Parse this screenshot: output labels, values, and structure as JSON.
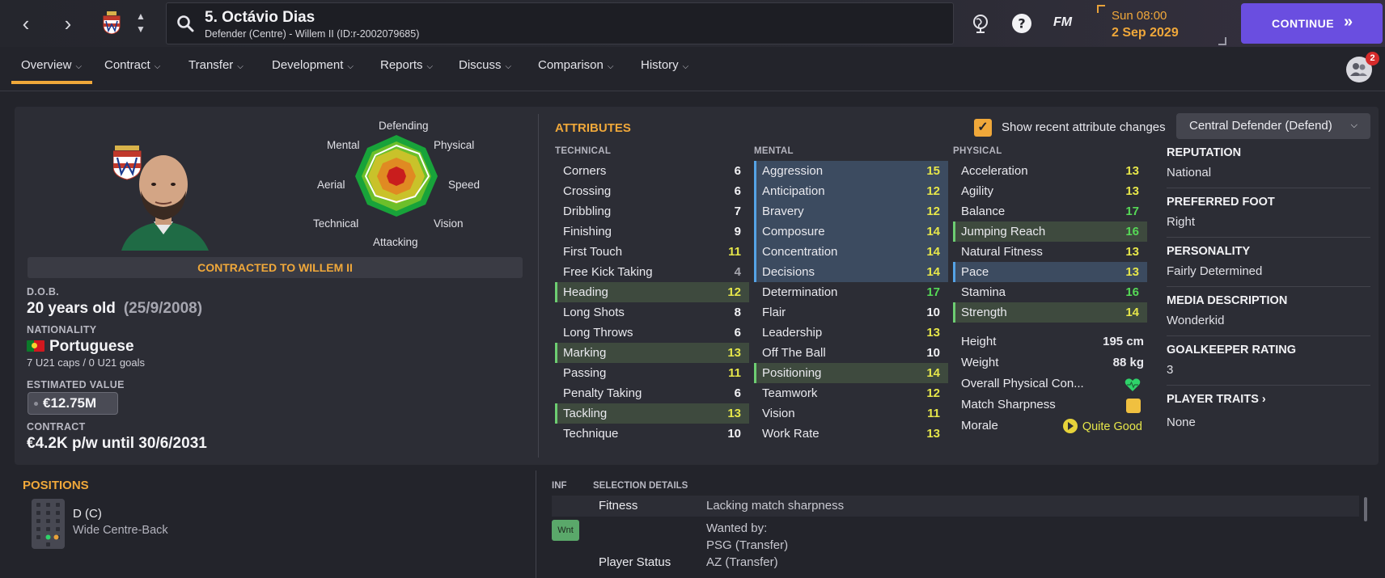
{
  "header": {
    "player_title": "5. Octávio Dias",
    "player_subtitle": "Defender (Centre) - Willem II (ID:r-2002079685)",
    "fm_logo": "FM",
    "date_time": "Sun 08:00",
    "date_day": "2 Sep 2029",
    "continue_label": "CONTINUE",
    "social_badge_count": "2"
  },
  "tabs": [
    {
      "label": "Overview"
    },
    {
      "label": "Contract"
    },
    {
      "label": "Transfer"
    },
    {
      "label": "Development"
    },
    {
      "label": "Reports"
    },
    {
      "label": "Discuss"
    },
    {
      "label": "Comparison"
    },
    {
      "label": "History"
    }
  ],
  "profile": {
    "contract_status": "CONTRACTED TO WILLEM II",
    "dob_label": "D.O.B.",
    "age": "20 years old",
    "dob": "(25/9/2008)",
    "nationality_label": "NATIONALITY",
    "nationality": "Portuguese",
    "caps": "7 U21 caps / 0 U21 goals",
    "value_label": "ESTIMATED VALUE",
    "value": "€12.75M",
    "contract_label": "CONTRACT",
    "contract": "€4.2K p/w until 30/6/2031"
  },
  "radar": {
    "labels": {
      "defending": "Defending",
      "physical": "Physical",
      "speed": "Speed",
      "vision": "Vision",
      "attacking": "Attacking",
      "technical": "Technical",
      "aerial": "Aerial",
      "mental": "Mental"
    }
  },
  "attributes": {
    "header": "ATTRIBUTES",
    "recent_changes_label": "Show recent attribute changes",
    "role": "Central Defender (Defend)",
    "technical_header": "TECHNICAL",
    "mental_header": "MENTAL",
    "physical_header": "PHYSICAL",
    "technical": [
      {
        "name": "Corners",
        "value": "6",
        "hl": ""
      },
      {
        "name": "Crossing",
        "value": "6",
        "hl": ""
      },
      {
        "name": "Dribbling",
        "value": "7",
        "hl": ""
      },
      {
        "name": "Finishing",
        "value": "9",
        "hl": ""
      },
      {
        "name": "First Touch",
        "value": "11",
        "hl": ""
      },
      {
        "name": "Free Kick Taking",
        "value": "4",
        "hl": ""
      },
      {
        "name": "Heading",
        "value": "12",
        "hl": "green"
      },
      {
        "name": "Long Shots",
        "value": "8",
        "hl": ""
      },
      {
        "name": "Long Throws",
        "value": "6",
        "hl": ""
      },
      {
        "name": "Marking",
        "value": "13",
        "hl": "green"
      },
      {
        "name": "Passing",
        "value": "11",
        "hl": ""
      },
      {
        "name": "Penalty Taking",
        "value": "6",
        "hl": ""
      },
      {
        "name": "Tackling",
        "value": "13",
        "hl": "green"
      },
      {
        "name": "Technique",
        "value": "10",
        "hl": ""
      }
    ],
    "mental": [
      {
        "name": "Aggression",
        "value": "15",
        "hl": "blue"
      },
      {
        "name": "Anticipation",
        "value": "12",
        "hl": "blue"
      },
      {
        "name": "Bravery",
        "value": "12",
        "hl": "blue"
      },
      {
        "name": "Composure",
        "value": "14",
        "hl": "blue"
      },
      {
        "name": "Concentration",
        "value": "14",
        "hl": "blue"
      },
      {
        "name": "Decisions",
        "value": "14",
        "hl": "blue"
      },
      {
        "name": "Determination",
        "value": "17",
        "hl": ""
      },
      {
        "name": "Flair",
        "value": "10",
        "hl": ""
      },
      {
        "name": "Leadership",
        "value": "13",
        "hl": ""
      },
      {
        "name": "Off The Ball",
        "value": "10",
        "hl": ""
      },
      {
        "name": "Positioning",
        "value": "14",
        "hl": "green"
      },
      {
        "name": "Teamwork",
        "value": "12",
        "hl": ""
      },
      {
        "name": "Vision",
        "value": "11",
        "hl": ""
      },
      {
        "name": "Work Rate",
        "value": "13",
        "hl": ""
      }
    ],
    "physical": [
      {
        "name": "Acceleration",
        "value": "13",
        "hl": ""
      },
      {
        "name": "Agility",
        "value": "13",
        "hl": ""
      },
      {
        "name": "Balance",
        "value": "17",
        "hl": ""
      },
      {
        "name": "Jumping Reach",
        "value": "16",
        "hl": "green"
      },
      {
        "name": "Natural Fitness",
        "value": "13",
        "hl": ""
      },
      {
        "name": "Pace",
        "value": "13",
        "hl": "blue"
      },
      {
        "name": "Stamina",
        "value": "16",
        "hl": ""
      },
      {
        "name": "Strength",
        "value": "14",
        "hl": "green"
      }
    ],
    "height_label": "Height",
    "height": "195 cm",
    "weight_label": "Weight",
    "weight": "88 kg",
    "condition_label": "Overall Physical Con...",
    "sharpness_label": "Match Sharpness",
    "morale_label": "Morale",
    "morale": "Quite Good"
  },
  "info": {
    "reputation_label": "REPUTATION",
    "reputation": "National",
    "foot_label": "PREFERRED FOOT",
    "foot": "Right",
    "personality_label": "PERSONALITY",
    "personality": "Fairly Determined",
    "media_label": "MEDIA DESCRIPTION",
    "media": "Wonderkid",
    "gk_label": "GOALKEEPER RATING",
    "gk": "3",
    "traits_label": "PLAYER TRAITS",
    "traits": "None"
  },
  "positions": {
    "header": "POSITIONS",
    "main": "D (C)",
    "role": "Wide Centre-Back"
  },
  "selection": {
    "inf_header": "INF",
    "details_header": "SELECTION DETAILS",
    "fitness_label": "Fitness",
    "fitness_value": "Lacking match sharpness",
    "wnt_badge": "Wnt",
    "wanted_label": "Wanted by:",
    "wanted_1": "PSG (Transfer)",
    "wanted_2": "AZ (Transfer)",
    "status_label": "Player Status"
  },
  "colors": {
    "accent": "#f0a83a",
    "continue": "#6a4ee0",
    "green_hl": "#6dcd72",
    "blue_hl": "#55a3e6"
  }
}
